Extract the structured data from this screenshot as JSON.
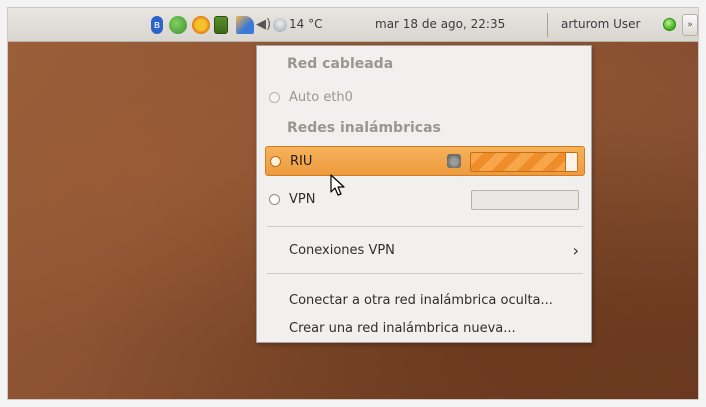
{
  "panel": {
    "temperature": "14 °C",
    "clock": "mar 18 de ago, 22:35",
    "user": "arturom User",
    "icons": [
      "bluetooth-icon",
      "update-icon",
      "weather-sun-icon",
      "battery-icon",
      "network-icon",
      "volume-icon",
      "weather-icon"
    ]
  },
  "menu": {
    "wired_title": "Red cableada",
    "wired_item": "Auto eth0",
    "wireless_title": "Redes inalámbricas",
    "networks": [
      {
        "label": "RIU",
        "signal": 0.9,
        "secured": true,
        "selected": true
      },
      {
        "label": "VPN",
        "signal": 0,
        "secured": false,
        "selected": false
      }
    ],
    "vpn_connections": "Conexiones VPN",
    "connect_hidden": "Conectar a otra red inalámbrica oculta...",
    "create_network": "Crear una red inalámbrica nueva..."
  },
  "colors": {
    "highlight": "#ee9b3d",
    "wallpaper": "#8b5232"
  }
}
